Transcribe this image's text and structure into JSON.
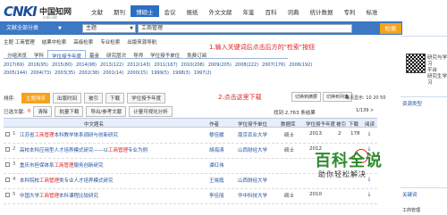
{
  "logo": {
    "mark": "CNKI",
    "name": "中国知网",
    "sub": "cnki.net"
  },
  "topnav": [
    "文献",
    "期刊",
    "博硕士",
    "会议",
    "报纸",
    "外文文献",
    "年鉴",
    "百科",
    "词典",
    "统计数据",
    "专利",
    "标准"
  ],
  "topnav_active": 2,
  "search": {
    "scope": "文献全部分类",
    "field": "主题",
    "query": "工商管理",
    "button": "检索"
  },
  "subnav": [
    "主题 工商管理",
    "结果中检索",
    "高级检索",
    "专业检索",
    "出版来源导航"
  ],
  "annotation1": "1.输入关键词后点击后方的\"检索\"按钮",
  "filter_tabs": [
    "分组浏览",
    "学科",
    "学位授予年度",
    "基金",
    "研究层次",
    "导师",
    "学位授予单位",
    "免费订阅"
  ],
  "filter_active": 2,
  "years_row1": [
    "2017(69)",
    "2016(95)",
    "2015(80)",
    "2014(98)",
    "2013(122)",
    "2012(143)",
    "2011(167)",
    "2010(208)",
    "2009(205)",
    "2008(222)",
    "2007(176)",
    "2006(192)"
  ],
  "years_row2": [
    "2005(144)",
    "2004(73)",
    "2003(35)",
    "2002(38)",
    "2001(14)",
    "2000(15)",
    "1999(5)",
    "1998(3)",
    "1997(2)"
  ],
  "sort_label": "排序:",
  "toolbar": [
    "主题排序",
    "出版时间",
    "被引",
    "下载",
    "学位授予年度"
  ],
  "toolbar_active": 0,
  "annotation2": "2.点击这里下载",
  "view_buttons": [
    "切换到摘要",
    "切换到列表"
  ],
  "per_page": "每页显示: 10 20 50",
  "selection": {
    "label": "已选文献:",
    "count": "0",
    "clear": "清除",
    "batch": "批量下载",
    "export": "导出/参考文献",
    "analyze": "计量可视化分析"
  },
  "found": "找到 2,763 条结果",
  "pager": "1/139 >",
  "table_headers": [
    "中文题名",
    "作者",
    "学位授予单位",
    "数据库",
    "学位授予年度",
    "被引",
    "下载",
    "阅读"
  ],
  "rows": [
    {
      "no": "1",
      "title_pre": "江苏省",
      "title_kw": "工商管理",
      "title_post": "本科教学体系调研与创新研究",
      "author": "黎佳媛",
      "unit": "南京农业大学",
      "db": "硕士",
      "year": "2013",
      "cite": "2",
      "dl": "178"
    },
    {
      "no": "2",
      "title_pre": "高校本科应用型人才培养模式研究——以",
      "title_kw": "工商管理",
      "title_post": "专业为例",
      "author": "胡海涛",
      "unit": "山西财经大学",
      "db": "硕士",
      "year": "2012",
      "cite": "",
      "dl": ""
    },
    {
      "no": "3",
      "title_pre": "重庆市担保体系",
      "title_kw": "工商管理",
      "title_post": "服务创新研究",
      "author": "谭红伟",
      "unit": "",
      "db": "",
      "year": "",
      "cite": "",
      "dl": ""
    },
    {
      "no": "4",
      "title_pre": "本科院校",
      "title_kw": "工商管理",
      "title_post": "类专业人才培养模式研究",
      "author": "王晓霞",
      "unit": "山西财经大学",
      "db": "",
      "year": "",
      "cite": "",
      "dl": ""
    },
    {
      "no": "5",
      "title_pre": "中国大学",
      "title_kw": "工商管理",
      "title_post": "本科课程比较研究",
      "author": "李佳丽",
      "unit": "华中科技大学",
      "db": "硕士",
      "year": "2010",
      "cite": "",
      "dl": ""
    }
  ],
  "right": {
    "promo": [
      "研究与学习",
      "平台",
      "研究生学习"
    ],
    "label": "资源类型",
    "label2": "关键词",
    "word": "工商管理"
  },
  "watermark": {
    "big": "百科全说",
    "small": "助你轻松解决"
  }
}
